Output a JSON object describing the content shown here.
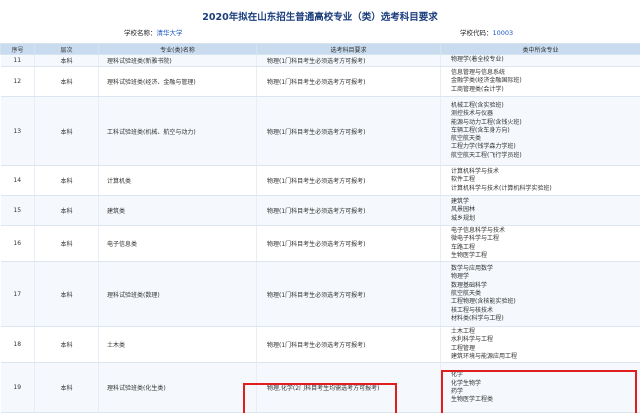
{
  "title": "2020年拟在山东招生普通高校专业（类）选考科目要求",
  "school": {
    "label": "学校名称：",
    "name": "清华大学"
  },
  "code": {
    "label": "学校代码：",
    "value": "10003"
  },
  "columns": [
    "序号",
    "层次",
    "专业(类)名称",
    "选考科目要求",
    "类中所含专业"
  ],
  "rows": [
    {
      "no": "11",
      "level": "本科",
      "major": "理科试验班类(新雅书院)",
      "req": "物理(1门科目考生必须选考方可报考)",
      "includes": [
        "物理学(着全校专业)"
      ]
    },
    {
      "no": "12",
      "level": "本科",
      "major": "理科试验班类(经济、金融与管理)",
      "req": "物理(1门科目考生必须选考方可报考)",
      "includes": [
        "信息管理与信息系统",
        "金融学类(经济金融国际班)",
        "工商管理类(会计学)"
      ]
    },
    {
      "no": "13",
      "level": "本科",
      "major": "工科试验班类(机械、航空与动力)",
      "req": "物理(1门科目考生必须选考方可报考)",
      "includes": [
        "机械工程(含实验班)",
        "测控技术与仪器",
        "能源与动力工程(含钱火班)",
        "车辆工程(含车身方向)",
        "航空航天类",
        "工程力学(钱学森力学班)",
        "航空航天工程(飞行学员班)"
      ]
    },
    {
      "no": "14",
      "level": "本科",
      "major": "计算机类",
      "req": "物理(1门科目考生必须选考方可报考)",
      "includes": [
        "计算机科学与技术",
        "软件工程",
        "计算机科学与技术(计算机科学实验班)"
      ]
    },
    {
      "no": "15",
      "level": "本科",
      "major": "建筑类",
      "req": "物理(1门科目考生必须选考方可报考)",
      "includes": [
        "建筑学",
        "风景园林",
        "城乡规划"
      ]
    },
    {
      "no": "16",
      "level": "本科",
      "major": "电子信息类",
      "req": "物理(1门科目考生必须选考方可报考)",
      "includes": [
        "电子信息科学与技术",
        "微电子科学与工程",
        "车路工程",
        "生物医学工程"
      ]
    },
    {
      "no": "17",
      "level": "本科",
      "major": "理科试验班类(数理)",
      "req": "物理(1门科目考生必须选考方可报考)",
      "includes": [
        "数学与应用数学",
        "物理学",
        "数理基础科学",
        "航空航天类",
        "工程物理(含核能实验班)",
        "核工程与核技术",
        "材料类(科学与工程)"
      ]
    },
    {
      "no": "18",
      "level": "本科",
      "major": "土木类",
      "req": "物理(1门科目考生必须选考方可报考)",
      "includes": [
        "土木工程",
        "水利科学与工程",
        "工程管理",
        "建筑环境与能源应用工程"
      ]
    },
    {
      "no": "19",
      "level": "本科",
      "major": "理科试验班类(化生类)",
      "req": "物理,化学(2门科目考生均需选考方可报考)",
      "includes": [
        "化学",
        "化学生物学",
        "药学",
        "生物医学工程类"
      ]
    }
  ]
}
